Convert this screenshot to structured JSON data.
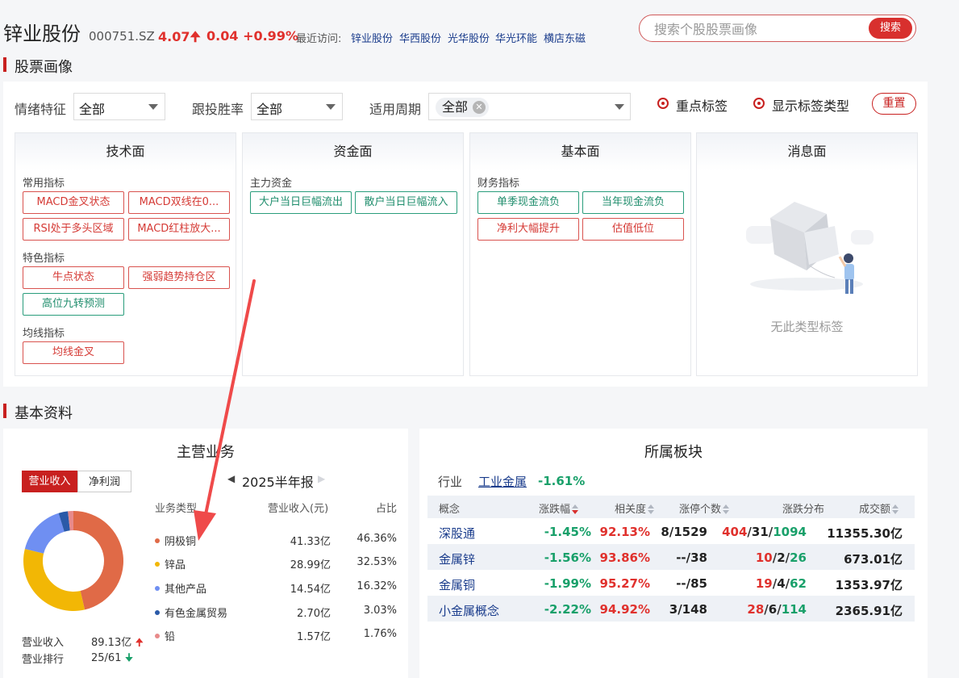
{
  "header": {
    "stock_name": "锌业股份",
    "stock_code": "000751.SZ",
    "price": "4.07",
    "change": "0.04",
    "change_pct": "+0.99%",
    "recent_label": "最近访问:",
    "recent_links": [
      "锌业股份",
      "华西股份",
      "光华股份",
      "华光环能",
      "横店东磁"
    ],
    "search_placeholder": "搜索个股股票画像",
    "search_button": "搜索"
  },
  "portrait": {
    "section_title": "股票画像",
    "filters": [
      {
        "label": "情绪特征",
        "value": "全部"
      },
      {
        "label": "跟投胜率",
        "value": "全部"
      },
      {
        "label": "适用周期",
        "value": "全部"
      }
    ],
    "radio_options": [
      "重点标签",
      "显示标签类型"
    ],
    "reset_button": "重置",
    "cards": [
      {
        "title": "技术面",
        "groups": [
          {
            "label": "常用指标",
            "tags": [
              "MACD金叉状态",
              "MACD双线在0...",
              "RSI处于多头区域",
              "MACD红柱放大..."
            ]
          },
          {
            "label": "特色指标",
            "tags": [
              "牛点状态",
              "强弱趋势持仓区",
              "高位九转预测"
            ]
          },
          {
            "label": "均线指标",
            "tags": [
              "均线金叉"
            ]
          }
        ]
      },
      {
        "title": "资金面",
        "groups": [
          {
            "label": "主力资金",
            "tags": [
              "大户当日巨幅流出",
              "散户当日巨幅流入"
            ]
          }
        ]
      },
      {
        "title": "基本面",
        "groups": [
          {
            "label": "财务指标",
            "tags": [
              "单季现金流负",
              "当年现金流负",
              "净利大幅提升",
              "估值低位"
            ]
          }
        ]
      },
      {
        "title": "消息面",
        "empty_text": "无此类型标签"
      }
    ]
  },
  "basic_info": {
    "section_title": "基本资料",
    "business": {
      "title": "主营业务",
      "toggle": [
        "营业收入",
        "净利润"
      ],
      "period": "2025半年报",
      "columns": [
        "业务类型",
        "营业收入(元)",
        "占比"
      ],
      "rows": [
        {
          "name": "阴极铜",
          "revenue": "41.33亿",
          "pct": "46.36%",
          "color": "#e06a47",
          "share": 46.36
        },
        {
          "name": "锌品",
          "revenue": "28.99亿",
          "pct": "32.53%",
          "color": "#f2b705",
          "share": 32.53
        },
        {
          "name": "其他产品",
          "revenue": "14.54亿",
          "pct": "16.32%",
          "color": "#6f8ff2",
          "share": 16.32
        },
        {
          "name": "有色金属贸易",
          "revenue": "2.70亿",
          "pct": "3.03%",
          "color": "#2a5aa8",
          "share": 3.03
        },
        {
          "name": "铅",
          "revenue": "1.57亿",
          "pct": "1.76%",
          "color": "#e88a8a",
          "share": 1.76
        }
      ],
      "total_label": "营业收入",
      "total_value": "89.13亿",
      "rank_label": "营业排行",
      "rank_value": "25/61"
    },
    "sector": {
      "title": "所属板块",
      "industry_label": "行业",
      "industry_name": "工业金属",
      "industry_change": "-1.61%",
      "columns": [
        "概念",
        "涨跌幅",
        "相关度",
        "涨停个数",
        "涨跌分布",
        "成交额"
      ],
      "rows": [
        {
          "name": "深股通",
          "change": "-1.45%",
          "corr": "92.13%",
          "limit": "8/1529",
          "dist_up": "404",
          "dist_flat": "31",
          "dist_down": "1094",
          "amount": "11355.30亿"
        },
        {
          "name": "金属锌",
          "change": "-1.56%",
          "corr": "93.86%",
          "limit": "--/38",
          "dist_up": "10",
          "dist_flat": "2",
          "dist_down": "26",
          "amount": "673.01亿"
        },
        {
          "name": "金属铜",
          "change": "-1.99%",
          "corr": "95.27%",
          "limit": "--/85",
          "dist_up": "19",
          "dist_flat": "4",
          "dist_down": "62",
          "amount": "1353.97亿"
        },
        {
          "name": "小金属概念",
          "change": "-2.22%",
          "corr": "94.92%",
          "limit": "3/148",
          "dist_up": "28",
          "dist_flat": "6",
          "dist_down": "114",
          "amount": "2365.91亿"
        }
      ]
    }
  },
  "colors": {
    "accent_red": "#d8302e",
    "up_red": "#e0312d",
    "down_green": "#19a06a",
    "link_blue": "#1a3c8c"
  }
}
